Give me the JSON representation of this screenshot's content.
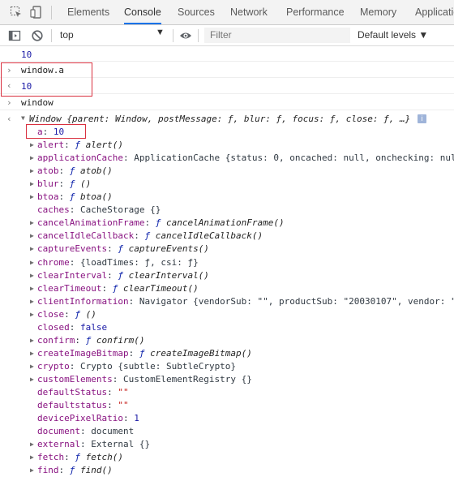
{
  "tabs": {
    "elements": "Elements",
    "console": "Console",
    "sources": "Sources",
    "network": "Network",
    "performance": "Performance",
    "memory": "Memory",
    "application": "Applicatio"
  },
  "toolbar": {
    "context": "top",
    "filter_placeholder": "Filter",
    "levels": "Default levels ▼"
  },
  "console": {
    "line1": "10",
    "input1": "window.a",
    "output1": "10",
    "input2": "window",
    "window_summary": "Window {parent: Window, postMessage: ƒ, blur: ƒ, focus: ƒ, close: ƒ, …}",
    "window_summary_prefix": "Window ",
    "info_icon": "i",
    "props": [
      {
        "key": "a",
        "sep": ": ",
        "value": "10"
      },
      {
        "key": "alert",
        "sep": ": ",
        "f": "ƒ ",
        "value": "alert()"
      },
      {
        "key": "applicationCache",
        "sep": ": ",
        "value": "ApplicationCache {status: 0, oncached: null, onchecking: nul"
      },
      {
        "key": "atob",
        "sep": ": ",
        "f": "ƒ ",
        "value": "atob()"
      },
      {
        "key": "blur",
        "sep": ": ",
        "f": "ƒ ",
        "value": "()"
      },
      {
        "key": "btoa",
        "sep": ": ",
        "f": "ƒ ",
        "value": "btoa()"
      },
      {
        "key": "caches",
        "sep": ": ",
        "value": "CacheStorage {}"
      },
      {
        "key": "cancelAnimationFrame",
        "sep": ": ",
        "f": "ƒ ",
        "value": "cancelAnimationFrame()"
      },
      {
        "key": "cancelIdleCallback",
        "sep": ": ",
        "f": "ƒ ",
        "value": "cancelIdleCallback()"
      },
      {
        "key": "captureEvents",
        "sep": ": ",
        "f": "ƒ ",
        "value": "captureEvents()"
      },
      {
        "key": "chrome",
        "sep": ": ",
        "value": "{loadTimes: ƒ, csi: ƒ}"
      },
      {
        "key": "clearInterval",
        "sep": ": ",
        "f": "ƒ ",
        "value": "clearInterval()"
      },
      {
        "key": "clearTimeout",
        "sep": ": ",
        "f": "ƒ ",
        "value": "clearTimeout()"
      },
      {
        "key": "clientInformation",
        "sep": ": ",
        "value": "Navigator {vendorSub: \"\", productSub: \"20030107\", vendor: \""
      },
      {
        "key": "close",
        "sep": ": ",
        "f": "ƒ ",
        "value": "()"
      },
      {
        "key": "closed",
        "sep": ": ",
        "value": "false"
      },
      {
        "key": "confirm",
        "sep": ": ",
        "f": "ƒ ",
        "value": "confirm()"
      },
      {
        "key": "createImageBitmap",
        "sep": ": ",
        "f": "ƒ ",
        "value": "createImageBitmap()"
      },
      {
        "key": "crypto",
        "sep": ": ",
        "value": "Crypto {subtle: SubtleCrypto}"
      },
      {
        "key": "customElements",
        "sep": ": ",
        "value": "CustomElementRegistry {}"
      },
      {
        "key": "defaultStatus",
        "sep": ": ",
        "value": "\"\""
      },
      {
        "key": "defaultstatus",
        "sep": ": ",
        "value": "\"\""
      },
      {
        "key": "devicePixelRatio",
        "sep": ": ",
        "value": "1"
      },
      {
        "key": "document",
        "sep": ": ",
        "value": "document"
      },
      {
        "key": "external",
        "sep": ": ",
        "value": "External {}"
      },
      {
        "key": "fetch",
        "sep": ": ",
        "f": "ƒ ",
        "value": "fetch()"
      },
      {
        "key": "find",
        "sep": ": ",
        "f": "ƒ ",
        "value": "find()"
      }
    ]
  },
  "colors": {
    "accent": "#1a73e8",
    "highlight_border": "#d9303f",
    "property_key": "#881280",
    "number": "#1a1aa6",
    "string": "#c41a16"
  }
}
